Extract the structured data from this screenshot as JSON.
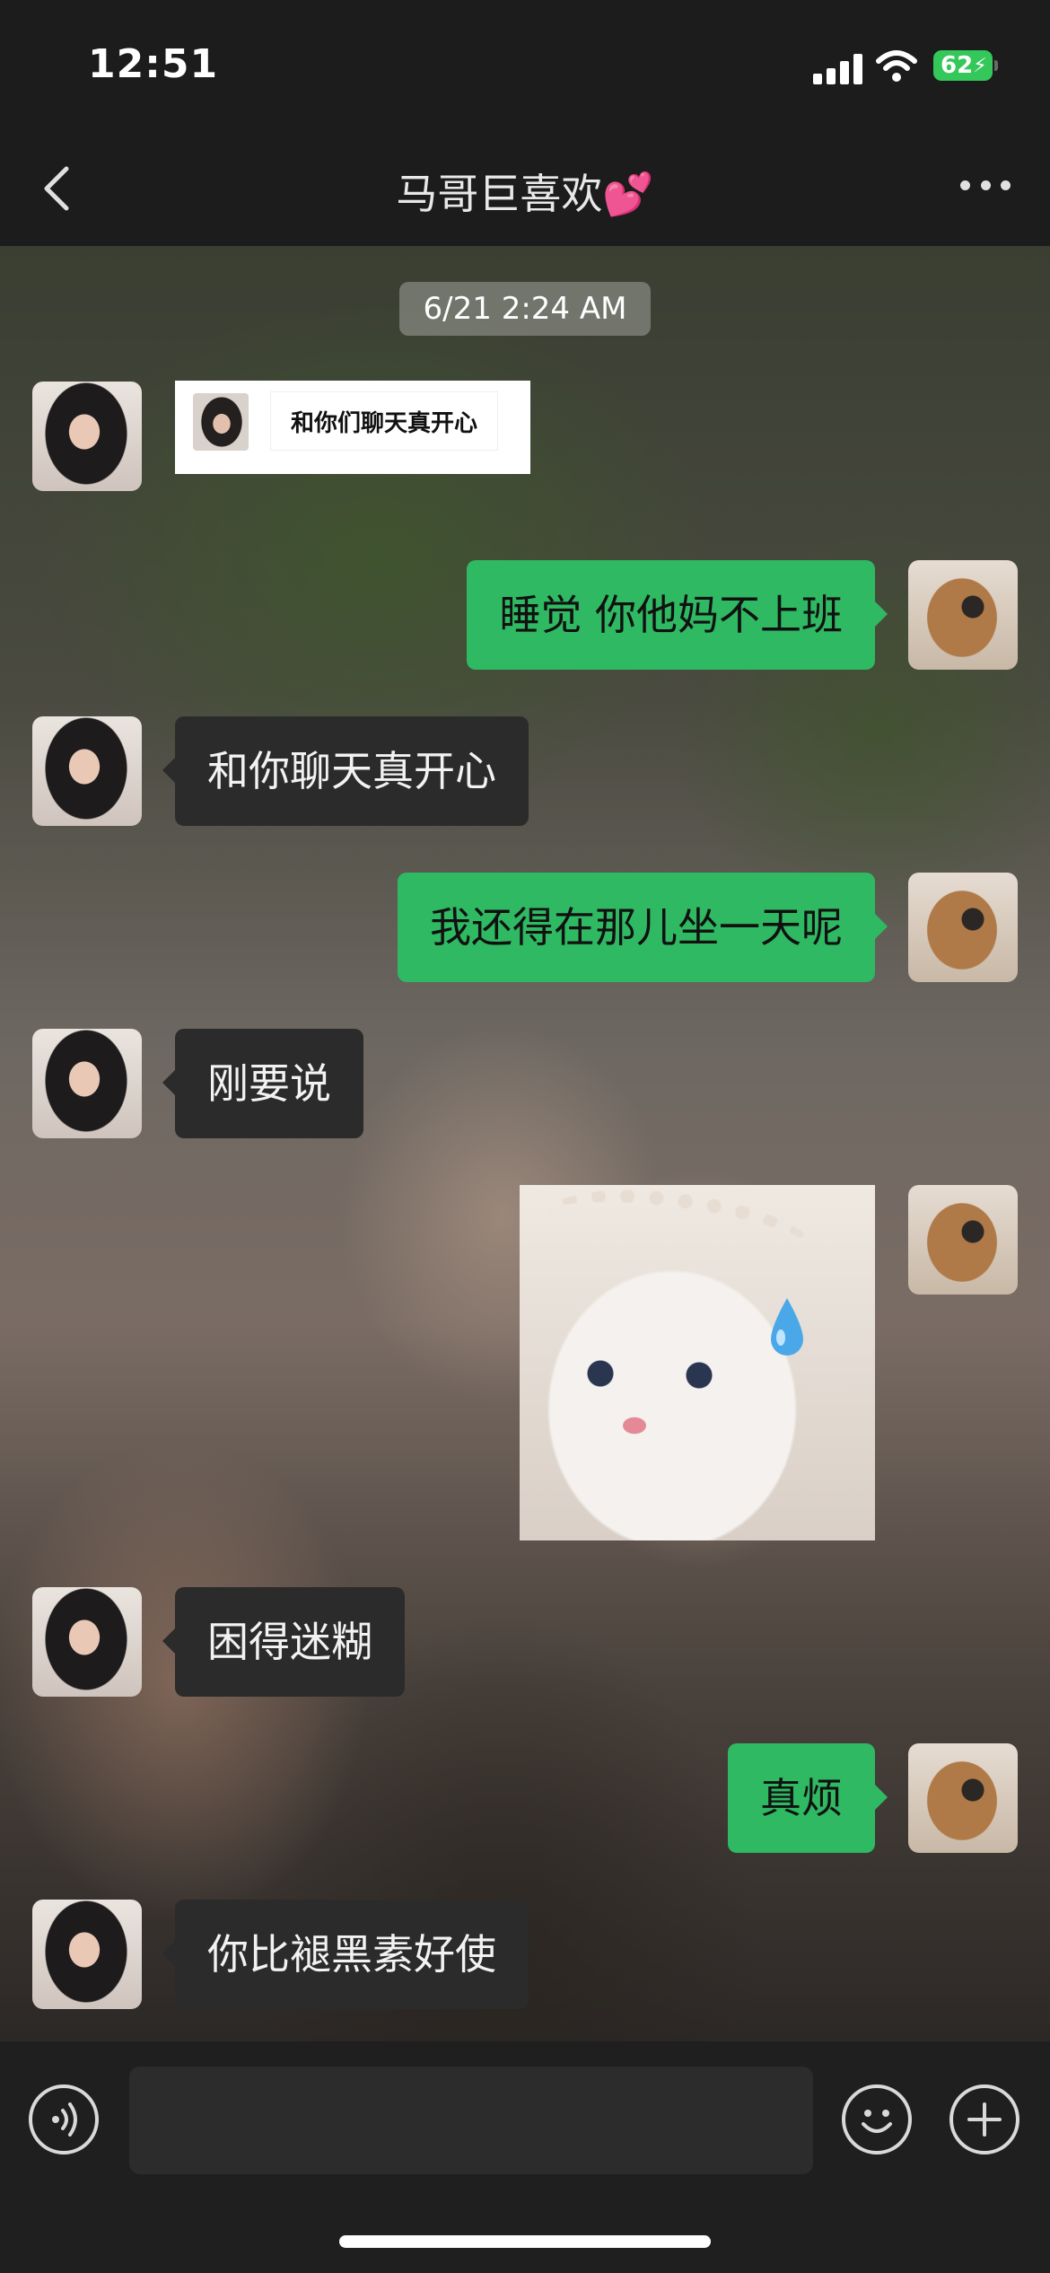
{
  "status_bar": {
    "time": "12:51",
    "battery": "62"
  },
  "header": {
    "title": "马哥巨喜欢💕"
  },
  "chat": {
    "timestamp": "6/21 2:24 AM",
    "quote_card_text": "和你们聊天真开心",
    "messages": [
      {
        "side": "right",
        "text": "睡觉 你他妈不上班"
      },
      {
        "side": "left",
        "text": "和你聊天真开心"
      },
      {
        "side": "right",
        "text": "我还得在那儿坐一天呢"
      },
      {
        "side": "left",
        "text": "刚要说"
      },
      {
        "side": "right",
        "type": "sticker",
        "sticker_icon": "crying-cat-sticker"
      },
      {
        "side": "left",
        "text": "困得迷糊"
      },
      {
        "side": "right",
        "text": "真烦"
      },
      {
        "side": "left",
        "text": "你比褪黑素好使"
      }
    ]
  },
  "colors": {
    "outgoing_bubble": "#2fb962",
    "incoming_bubble": "#2b2b2b",
    "bar_bg": "#1c1c1c"
  }
}
